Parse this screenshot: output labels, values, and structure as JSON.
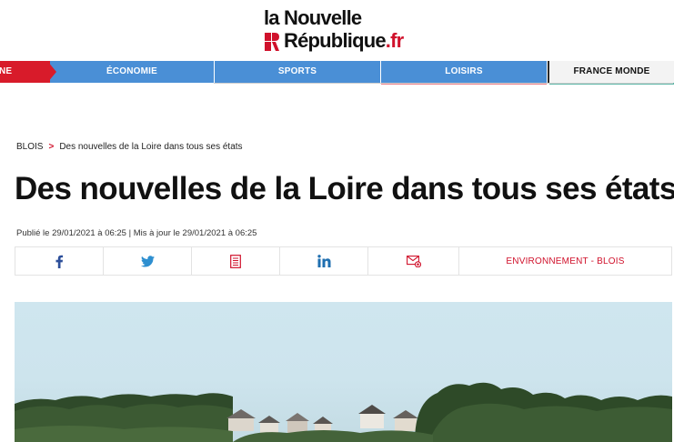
{
  "logo": {
    "line1": "la Nouvelle",
    "line2_main": "République",
    "line2_suffix": ".fr"
  },
  "nav": {
    "items": [
      {
        "label": "NE"
      },
      {
        "label": "ÉCONOMIE"
      },
      {
        "label": "SPORTS"
      },
      {
        "label": "LOISIRS"
      },
      {
        "label": "FRANCE MONDE"
      }
    ]
  },
  "breadcrumb": {
    "section": "BLOIS",
    "separator": ">",
    "current": "Des nouvelles de la Loire dans tous ses états"
  },
  "article": {
    "title": "Des nouvelles de la Loire dans tous ses états",
    "dates": "Publié le 29/01/2021 à 06:25 | Mis à jour le 29/01/2021 à 06:25"
  },
  "share": {
    "icons": [
      "facebook-icon",
      "twitter-icon",
      "print-icon",
      "linkedin-icon",
      "email-icon"
    ],
    "tags": "ENVIRONNEMENT  - BLOIS"
  },
  "colors": {
    "brand_red": "#d0112b",
    "nav_blue": "#4a8fd6",
    "nav_red": "#d81b2a"
  }
}
